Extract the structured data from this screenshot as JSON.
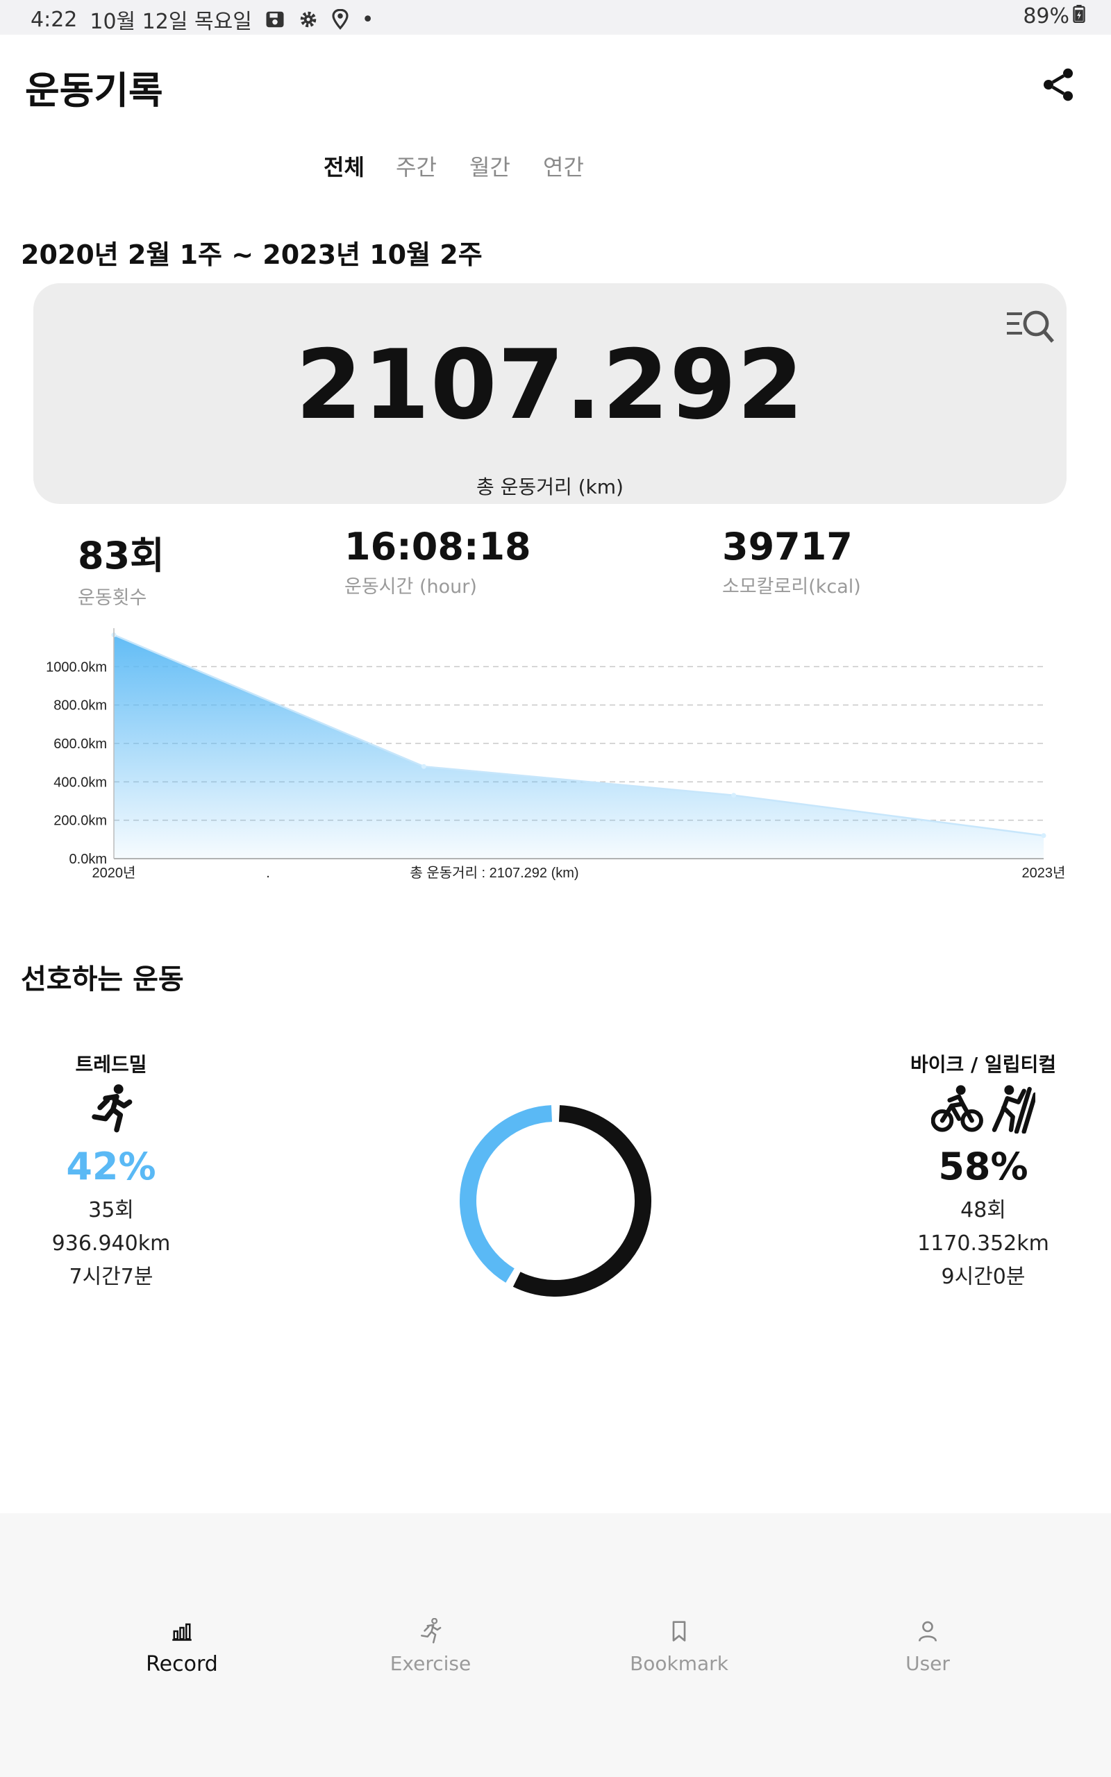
{
  "status_bar": {
    "time": "4:22",
    "date": "10월 12일 목요일",
    "dot": "•",
    "battery": "89%"
  },
  "app": {
    "title": "운동기록"
  },
  "tabs": [
    {
      "label": "전체",
      "active": true
    },
    {
      "label": "주간",
      "active": false
    },
    {
      "label": "월간",
      "active": false
    },
    {
      "label": "연간",
      "active": false
    }
  ],
  "range_label": "2020년 2월 1주 ~ 2023년 10월 2주",
  "summary": {
    "total_distance": "2107.292",
    "total_distance_label": "총 운동거리 (km)"
  },
  "stats": [
    {
      "value": "83회",
      "label": "운동횟수"
    },
    {
      "value": "16:08:18",
      "label": "운동시간 (hour)"
    },
    {
      "value": "39717",
      "label": "소모칼로리(kcal)"
    }
  ],
  "chart_data": {
    "type": "area",
    "x": [
      "2020년",
      ".",
      "",
      "2023년"
    ],
    "values": [
      1165,
      480,
      330,
      120
    ],
    "xlabel": "총 운동거리 : 2107.292 (km)",
    "ylabel": "",
    "ylim": [
      0,
      1200
    ],
    "yticks": [
      "0.0km",
      "200.0km",
      "400.0km",
      "600.0km",
      "800.0km",
      "1000.0km"
    ],
    "grid": true,
    "fill_color": "#5ab9f5"
  },
  "favorite": {
    "title": "선호하는 운동",
    "left": {
      "name": "트레드밀",
      "percent": "42%",
      "count": "35회",
      "distance": "936.940km",
      "time": "7시간7분",
      "icon": "running-icon",
      "color": "#5ab9f5"
    },
    "right": {
      "name": "바이크 / 일립티컬",
      "percent": "58%",
      "count": "48회",
      "distance": "1170.352km",
      "time": "9시간0분",
      "icon": "bike-icon",
      "color": "#111111"
    },
    "donut": {
      "share_left": 0.42,
      "share_right": 0.58,
      "color_left": "#5ab9f5",
      "color_right": "#111111"
    }
  },
  "bottom_nav": [
    {
      "label": "Record",
      "icon": "bar-chart-icon",
      "active": true
    },
    {
      "label": "Exercise",
      "icon": "running-icon",
      "active": false
    },
    {
      "label": "Bookmark",
      "icon": "bookmark-icon",
      "active": false
    },
    {
      "label": "User",
      "icon": "user-icon",
      "active": false
    }
  ]
}
